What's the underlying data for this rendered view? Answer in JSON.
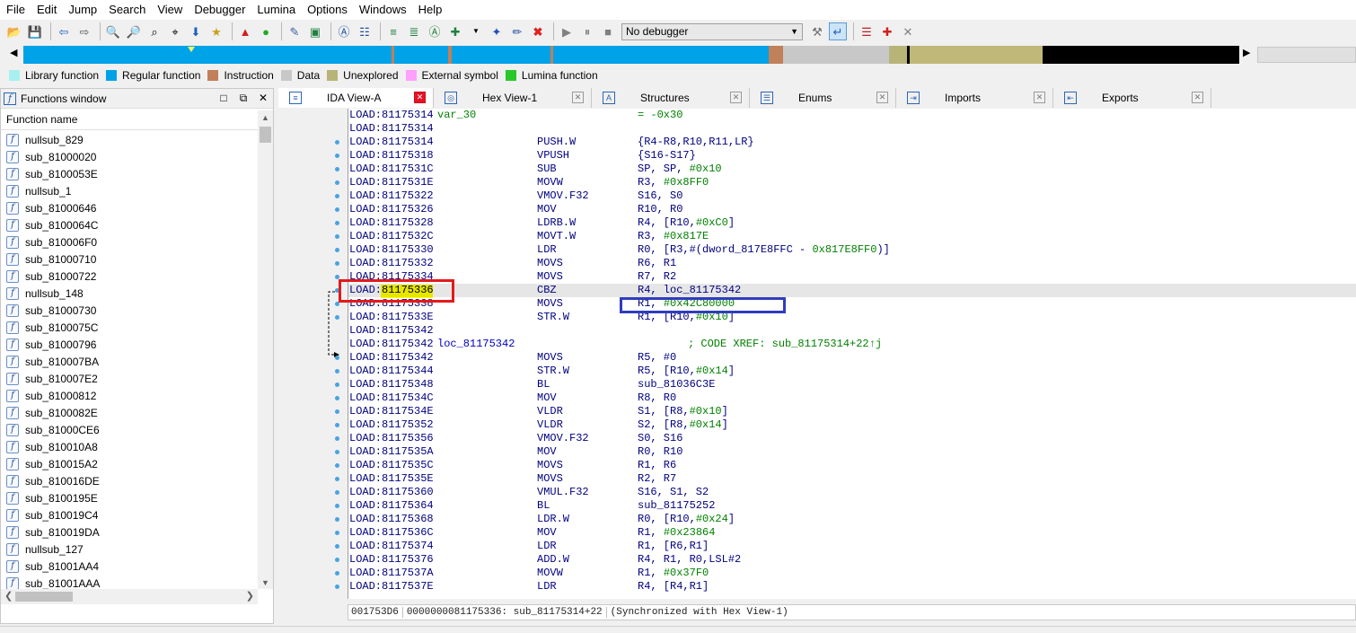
{
  "menu": [
    "File",
    "Edit",
    "Jump",
    "Search",
    "View",
    "Debugger",
    "Lumina",
    "Options",
    "Windows",
    "Help"
  ],
  "toolbar": {
    "debugger_select": "No debugger"
  },
  "nav_band_colors": {
    "regular": "#00a2e8",
    "instruction": "#c0805a",
    "data": "#c8c8c8",
    "unexplored": "#c0b878",
    "black": "#000000"
  },
  "legend": [
    {
      "label": "Library function",
      "color": "#a8f0f0"
    },
    {
      "label": "Regular function",
      "color": "#00a2e8"
    },
    {
      "label": "Instruction",
      "color": "#c0805a"
    },
    {
      "label": "Data",
      "color": "#c8c8c8"
    },
    {
      "label": "Unexplored",
      "color": "#b8b478"
    },
    {
      "label": "External symbol",
      "color": "#ffa0ff"
    },
    {
      "label": "Lumina function",
      "color": "#28c828"
    }
  ],
  "functions_window": {
    "title": "Functions window",
    "column": "Function name",
    "items": [
      "nullsub_829",
      "sub_81000020",
      "sub_8100053E",
      "nullsub_1",
      "sub_81000646",
      "sub_8100064C",
      "sub_810006F0",
      "sub_81000710",
      "sub_81000722",
      "nullsub_148",
      "sub_81000730",
      "sub_8100075C",
      "sub_81000796",
      "sub_810007BA",
      "sub_810007E2",
      "sub_81000812",
      "sub_8100082E",
      "sub_81000CE6",
      "sub_810010A8",
      "sub_810015A2",
      "sub_810016DE",
      "sub_8100195E",
      "sub_810019C4",
      "sub_810019DA",
      "nullsub_127",
      "sub_81001AA4",
      "sub_81001AAA"
    ]
  },
  "tabs": [
    {
      "label": "IDA View-A",
      "icon": "ida-view-icon",
      "active": true
    },
    {
      "label": "Hex View-1",
      "icon": "hex-view-icon",
      "active": false
    },
    {
      "label": "Structures",
      "icon": "structures-icon",
      "active": false
    },
    {
      "label": "Enums",
      "icon": "enums-icon",
      "active": false
    },
    {
      "label": "Imports",
      "icon": "imports-icon",
      "active": false
    },
    {
      "label": "Exports",
      "icon": "exports-icon",
      "active": false
    }
  ],
  "disasm": [
    {
      "addr": "LOAD:81175314",
      "label": "var_30",
      "op": "",
      "arg": "= -0x30",
      "comment": ""
    },
    {
      "addr": "LOAD:81175314",
      "label": "",
      "op": "",
      "arg": "",
      "comment": ""
    },
    {
      "addr": "LOAD:81175314",
      "label": "",
      "op": "PUSH.W",
      "arg": "{R4-R8,R10,R11,LR}",
      "comment": ""
    },
    {
      "addr": "LOAD:81175318",
      "label": "",
      "op": "VPUSH",
      "arg": "{S16-S17}",
      "comment": ""
    },
    {
      "addr": "LOAD:8117531C",
      "label": "",
      "op": "SUB",
      "arg": "SP, SP, #0x10",
      "comment": ""
    },
    {
      "addr": "LOAD:8117531E",
      "label": "",
      "op": "MOVW",
      "arg": "R3, #0x8FF0",
      "comment": ""
    },
    {
      "addr": "LOAD:81175322",
      "label": "",
      "op": "VMOV.F32",
      "arg": "S16, S0",
      "comment": ""
    },
    {
      "addr": "LOAD:81175326",
      "label": "",
      "op": "MOV",
      "arg": "R10, R0",
      "comment": ""
    },
    {
      "addr": "LOAD:81175328",
      "label": "",
      "op": "LDRB.W",
      "arg": "R4, [R10,#0xC0]",
      "comment": ""
    },
    {
      "addr": "LOAD:8117532C",
      "label": "",
      "op": "MOVT.W",
      "arg": "R3, #0x817E",
      "comment": ""
    },
    {
      "addr": "LOAD:81175330",
      "label": "",
      "op": "LDR",
      "arg": "R0, [R3,#(dword_817E8FFC - 0x817E8FF0)]",
      "comment": ""
    },
    {
      "addr": "LOAD:81175332",
      "label": "",
      "op": "MOVS",
      "arg": "R6, R1",
      "comment": ""
    },
    {
      "addr": "LOAD:81175334",
      "label": "",
      "op": "MOVS",
      "arg": "R7, R2",
      "comment": ""
    },
    {
      "addr": "LOAD:81175336",
      "label": "",
      "op": "CBZ",
      "arg": "R4, loc_81175342",
      "comment": ""
    },
    {
      "addr": "LOAD:81175338",
      "label": "",
      "op": "MOVS",
      "arg": "R1, #0x42C80000",
      "comment": ""
    },
    {
      "addr": "LOAD:8117533E",
      "label": "",
      "op": "STR.W",
      "arg": "R1, [R10,#0x10]",
      "comment": ""
    },
    {
      "addr": "LOAD:81175342",
      "label": "",
      "op": "",
      "arg": "",
      "comment": ""
    },
    {
      "addr": "LOAD:81175342",
      "label": "loc_81175342",
      "op": "",
      "arg": "",
      "comment": "; CODE XREF: sub_81175314+22↑j"
    },
    {
      "addr": "LOAD:81175342",
      "label": "",
      "op": "MOVS",
      "arg": "R5, #0",
      "comment": ""
    },
    {
      "addr": "LOAD:81175344",
      "label": "",
      "op": "STR.W",
      "arg": "R5, [R10,#0x14]",
      "comment": ""
    },
    {
      "addr": "LOAD:81175348",
      "label": "",
      "op": "BL",
      "arg": "sub_81036C3E",
      "comment": ""
    },
    {
      "addr": "LOAD:8117534C",
      "label": "",
      "op": "MOV",
      "arg": "R8, R0",
      "comment": ""
    },
    {
      "addr": "LOAD:8117534E",
      "label": "",
      "op": "VLDR",
      "arg": "S1, [R8,#0x10]",
      "comment": ""
    },
    {
      "addr": "LOAD:81175352",
      "label": "",
      "op": "VLDR",
      "arg": "S2, [R8,#0x14]",
      "comment": ""
    },
    {
      "addr": "LOAD:81175356",
      "label": "",
      "op": "VMOV.F32",
      "arg": "S0, S16",
      "comment": ""
    },
    {
      "addr": "LOAD:8117535A",
      "label": "",
      "op": "MOV",
      "arg": "R0, R10",
      "comment": ""
    },
    {
      "addr": "LOAD:8117535C",
      "label": "",
      "op": "MOVS",
      "arg": "R1, R6",
      "comment": ""
    },
    {
      "addr": "LOAD:8117535E",
      "label": "",
      "op": "MOVS",
      "arg": "R2, R7",
      "comment": ""
    },
    {
      "addr": "LOAD:81175360",
      "label": "",
      "op": "VMUL.F32",
      "arg": "S16, S1, S2",
      "comment": ""
    },
    {
      "addr": "LOAD:81175364",
      "label": "",
      "op": "BL",
      "arg": "sub_81175252",
      "comment": ""
    },
    {
      "addr": "LOAD:81175368",
      "label": "",
      "op": "LDR.W",
      "arg": "R0, [R10,#0x24]",
      "comment": ""
    },
    {
      "addr": "LOAD:8117536C",
      "label": "",
      "op": "MOV",
      "arg": "R1, #0x23864",
      "comment": ""
    },
    {
      "addr": "LOAD:81175374",
      "label": "",
      "op": "LDR",
      "arg": "R1, [R6,R1]",
      "comment": ""
    },
    {
      "addr": "LOAD:81175376",
      "label": "",
      "op": "ADD.W",
      "arg": "R4, R1, R0,LSL#2",
      "comment": ""
    },
    {
      "addr": "LOAD:8117537A",
      "label": "",
      "op": "MOVW",
      "arg": "R1, #0x37F0",
      "comment": ""
    },
    {
      "addr": "LOAD:8117537E",
      "label": "",
      "op": "LDR",
      "arg": "R4, [R4,R1]",
      "comment": ""
    }
  ],
  "status": {
    "offset": "001753D6",
    "location": "0000000081175336: sub_81175314+22",
    "sync": "(Synchronized with Hex View-1)"
  }
}
